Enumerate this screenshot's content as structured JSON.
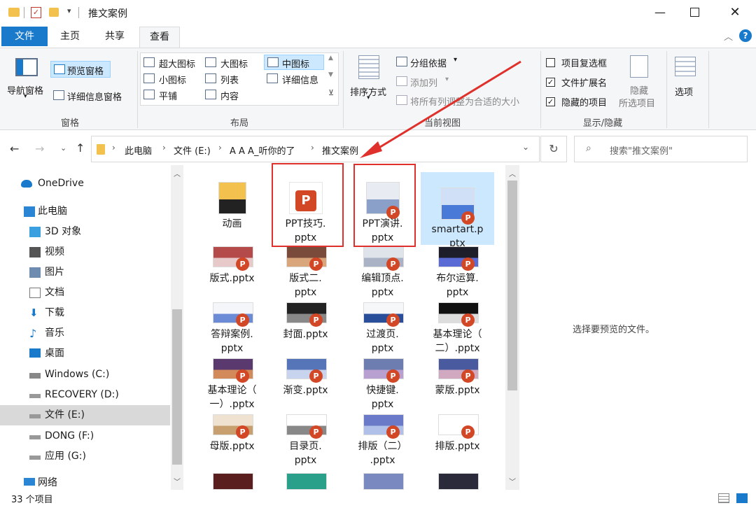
{
  "window": {
    "title": "推文案例"
  },
  "tabs": [
    "文件",
    "主页",
    "共享",
    "查看"
  ],
  "ribbon": {
    "panes": {
      "nav_pane": "导航窗格",
      "preview_pane": "预览窗格",
      "details_pane": "详细信息窗格",
      "group": "窗格"
    },
    "layout": {
      "items": [
        "超大图标",
        "大图标",
        "中图标",
        "小图标",
        "列表",
        "详细信息",
        "平铺",
        "内容"
      ],
      "group": "布局"
    },
    "current_view": {
      "sort": "排序方式",
      "group_by": "分组依据",
      "add_column": "添加列",
      "size_all": "将所有列调整为合适的大小",
      "group": "当前视图"
    },
    "show_hide": {
      "item_checkbox": "项目复选框",
      "file_ext": "文件扩展名",
      "hidden_items": "隐藏的项目",
      "hide": "隐藏",
      "hide2": "所选项目",
      "group": "显示/隐藏"
    },
    "options": "选项"
  },
  "address": {
    "crumbs": [
      "此电脑",
      "文件 (E:)",
      "A A A_听你的了",
      "推文案例"
    ]
  },
  "search": {
    "placeholder": "搜索\"推文案例\""
  },
  "nav": [
    "OneDrive",
    "此电脑",
    "3D 对象",
    "视频",
    "图片",
    "文档",
    "下载",
    "音乐",
    "桌面",
    "Windows (C:)",
    "RECOVERY (D:)",
    "文件 (E:)",
    "DONG (F:)",
    "应用 (G:)",
    "网络"
  ],
  "files": [
    {
      "line1": "动画",
      "line2": ""
    },
    {
      "line1": "PPT技巧.",
      "line2": "pptx"
    },
    {
      "line1": "PPT演讲.",
      "line2": "pptx"
    },
    {
      "line1": "smartart.p",
      "line2": "ptx"
    },
    {
      "line1": "版式.pptx",
      "line2": ""
    },
    {
      "line1": "版式二.",
      "line2": "pptx"
    },
    {
      "line1": "编辑顶点.",
      "line2": "pptx"
    },
    {
      "line1": "布尔运算.",
      "line2": "pptx"
    },
    {
      "line1": "答辩案例.",
      "line2": "pptx"
    },
    {
      "line1": "封面.pptx",
      "line2": ""
    },
    {
      "line1": "过渡页.",
      "line2": "pptx"
    },
    {
      "line1": "基本理论（",
      "line2": "二）.pptx"
    },
    {
      "line1": "基本理论（",
      "line2": "一）.pptx"
    },
    {
      "line1": "渐变.pptx",
      "line2": ""
    },
    {
      "line1": "快捷键.",
      "line2": "pptx"
    },
    {
      "line1": "蒙版.pptx",
      "line2": ""
    },
    {
      "line1": "母版.pptx",
      "line2": ""
    },
    {
      "line1": "目录页.",
      "line2": "pptx"
    },
    {
      "line1": "排版（二）",
      "line2": ".pptx"
    },
    {
      "line1": "排版.pptx",
      "line2": ""
    }
  ],
  "preview": {
    "empty_text": "选择要预览的文件。"
  },
  "status": {
    "count": "33 个项目"
  },
  "colors": {
    "accent": "#1979ca",
    "highlight": "#cce8ff",
    "annotation": "#e0302b",
    "ppt": "#d24726"
  }
}
